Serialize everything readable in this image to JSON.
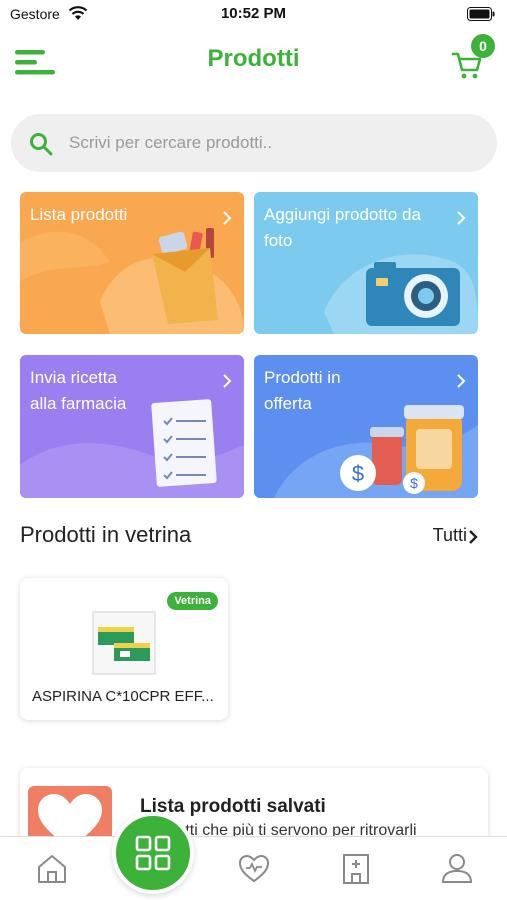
{
  "status_bar": {
    "carrier": "Gestore",
    "time": "10:52 PM"
  },
  "header": {
    "title": "Prodotti",
    "cart_count": "0"
  },
  "search": {
    "placeholder": "Scrivi per cercare prodotti.."
  },
  "tiles": [
    {
      "label": "Lista prodotti",
      "color": "#f9a84f"
    },
    {
      "label": "Aggiungi prodotto da foto",
      "color": "#7ccbee"
    },
    {
      "label": "Invia ricetta alla farmacia",
      "color": "#9b7ef0"
    },
    {
      "label": "Prodotti in offerta",
      "color": "#5c8ff0"
    }
  ],
  "showcase": {
    "title": "Prodotti in vetrina",
    "see_all": "Tutti",
    "products": [
      {
        "badge": "Vetrina",
        "name": "ASPIRINA C*10CPR EFF..."
      }
    ]
  },
  "saved_lists": {
    "title": "Lista prodotti salvati",
    "subtitle": "...rodotti che più ti servono per ritrovarli"
  },
  "tabbar": {
    "items": [
      {
        "icon": "home-icon"
      },
      {
        "icon": "grid-icon"
      },
      {
        "icon": "heart-icon"
      },
      {
        "icon": "pharmacy-icon"
      },
      {
        "icon": "profile-icon"
      }
    ]
  },
  "colors": {
    "brand_green": "#3db23a"
  }
}
